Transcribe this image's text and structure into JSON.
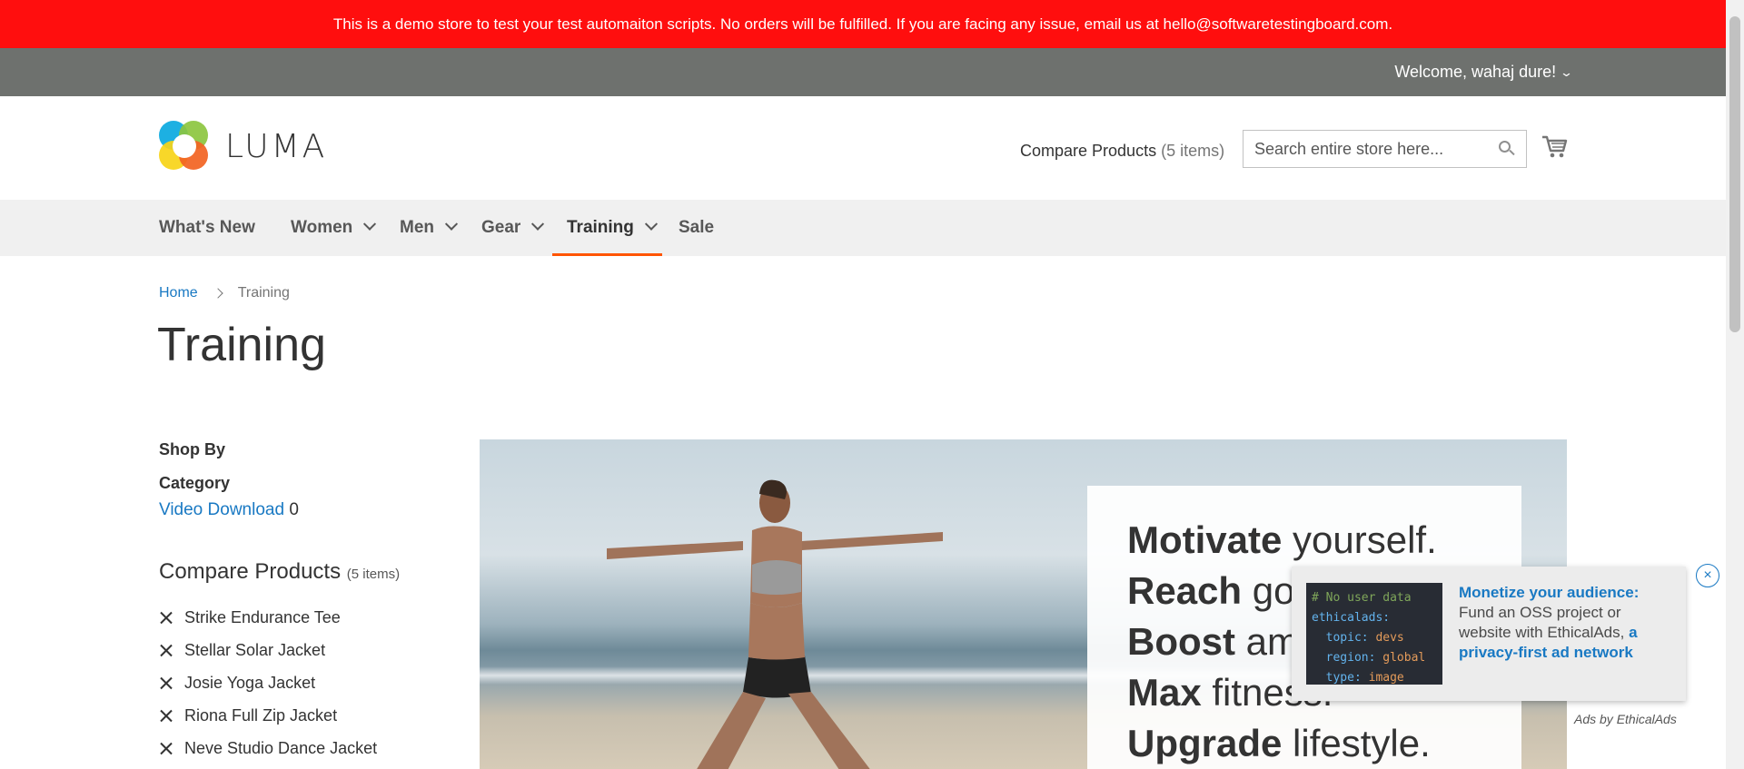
{
  "demo_banner": "This is a demo store to test your test automaiton scripts. No orders will be fulfilled. If you are facing any issue, email us at hello@softwaretestingboard.com.",
  "topbar": {
    "welcome": "Welcome, wahaj dure!"
  },
  "header": {
    "logo_text": "LUMA",
    "compare_label": "Compare Products",
    "compare_count": "(5 items)",
    "search_placeholder": "Search entire store here...",
    "cart_icon": "shopping-cart-icon"
  },
  "nav": [
    {
      "label": "What's New"
    },
    {
      "label": "Women"
    },
    {
      "label": "Men"
    },
    {
      "label": "Gear"
    },
    {
      "label": "Training"
    },
    {
      "label": "Sale"
    }
  ],
  "breadcrumb": {
    "home": "Home",
    "current": "Training"
  },
  "page_title": "Training",
  "sidebar": {
    "shop_by": "Shop By",
    "category_title": "Category",
    "category_items": [
      {
        "label": "Video Download",
        "count": "0"
      }
    ],
    "compare_title": "Compare Products",
    "compare_count": "(5 items)",
    "compare_items": [
      "Strike Endurance Tee",
      "Stellar Solar Jacket",
      "Josie Yoga Jacket",
      "Riona Full Zip Jacket",
      "Neve Studio Dance Jacket"
    ]
  },
  "hero": {
    "lines": [
      {
        "bold": "Motivate",
        "light": " yourself."
      },
      {
        "bold": "Reach",
        "light": " goals."
      },
      {
        "bold": "Boost",
        "light": " ambition."
      },
      {
        "bold": "Max",
        "light": " fitness."
      },
      {
        "bold": "Upgrade",
        "light": " lifestyle."
      }
    ]
  },
  "ad": {
    "close": "×",
    "code": {
      "comment": "# No user data",
      "key": "ethicalads:",
      "topic_k": "topic:",
      "topic_v": "devs",
      "region_k": "region:",
      "region_v": "global",
      "type_k": "type:",
      "type_v": "image"
    },
    "headline": "Monetize your audience:",
    "body": "Fund an OSS project or website with EthicalAds,",
    "link": "a privacy-first ad network",
    "footer": "Ads by EthicalAds"
  }
}
